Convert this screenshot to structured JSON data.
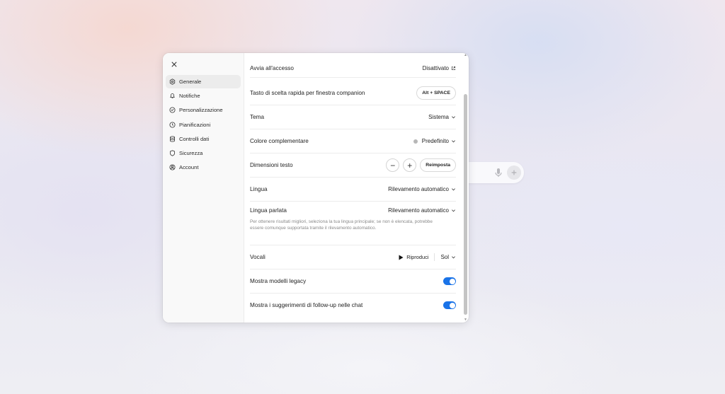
{
  "window": {
    "close_label": "×"
  },
  "sidebar": {
    "items": [
      {
        "label": "Generale",
        "icon": "gear-icon",
        "active": true
      },
      {
        "label": "Notifiche",
        "icon": "bell-icon"
      },
      {
        "label": "Personalizzazione",
        "icon": "personalization-icon"
      },
      {
        "label": "Pianificazioni",
        "icon": "clock-icon"
      },
      {
        "label": "Controlli dati",
        "icon": "database-icon"
      },
      {
        "label": "Sicurezza",
        "icon": "shield-icon"
      },
      {
        "label": "Account",
        "icon": "account-icon"
      }
    ]
  },
  "settings": {
    "launch": {
      "label": "Avvia all'accesso",
      "value": "Disattivato"
    },
    "shortcut": {
      "label": "Tasto di scelta rapida per finestra companion",
      "value": "Alt + SPACE"
    },
    "theme": {
      "label": "Tema",
      "value": "Sistema"
    },
    "accent": {
      "label": "Colore complementare",
      "value": "Predefinito",
      "color": "#b7b7b7"
    },
    "text_size": {
      "label": "Dimensioni testo",
      "minus": "−",
      "plus": "+",
      "reset": "Reimposta"
    },
    "language": {
      "label": "Lingua",
      "value": "Rilevamento automatico"
    },
    "spoken_language": {
      "label": "Lingua parlata",
      "value": "Rilevamento automatico",
      "helper": "Per ottenere risultati migliori, seleziona la tua lingua principale; se non è elencata, potrebbe essere comunque supportata tramite il rilevamento automatico."
    },
    "voice": {
      "label": "Vocali",
      "play": "Riproduci",
      "value": "Sol"
    },
    "legacy_models": {
      "label": "Mostra modelli legacy",
      "enabled": true
    },
    "followup": {
      "label": "Mostra i suggerimenti di follow-up nelle chat",
      "enabled": true
    }
  },
  "colors": {
    "accent": "#1a73e8"
  }
}
